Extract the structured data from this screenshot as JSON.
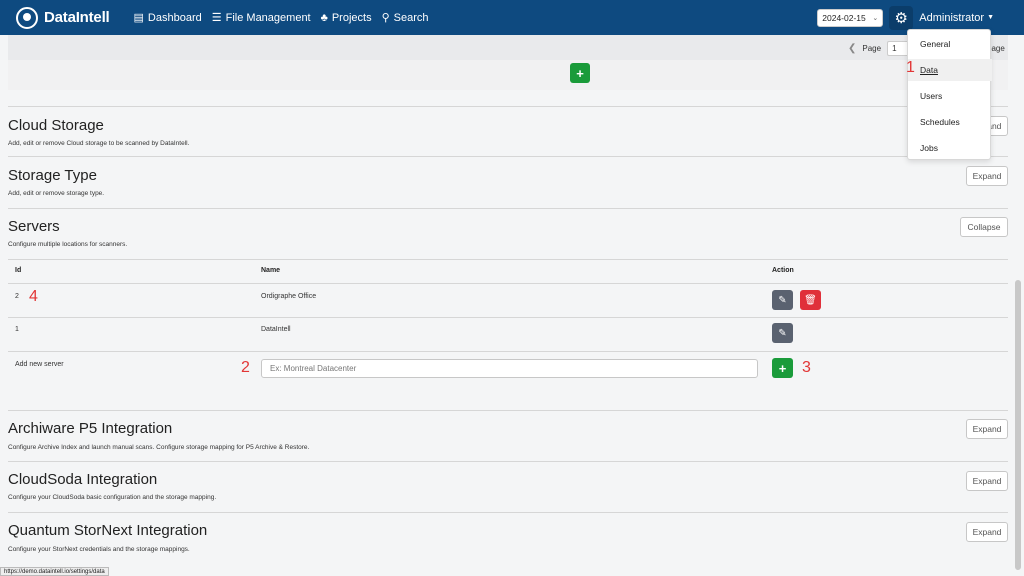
{
  "nav": {
    "brand": "DataIntell",
    "links": [
      {
        "icon": "bar-chart-icon",
        "label": "Dashboard"
      },
      {
        "icon": "list-icon",
        "label": "File Management"
      },
      {
        "icon": "sitemap-icon",
        "label": "Projects"
      },
      {
        "icon": "search-icon",
        "label": "Search"
      }
    ],
    "date": "2024-02-15",
    "user": "Administrator"
  },
  "pager": {
    "label": "Page",
    "value": "1",
    "suffix": "page"
  },
  "settings_menu": {
    "items": [
      "General",
      "Data",
      "Users",
      "Schedules",
      "Jobs"
    ],
    "active": "Data"
  },
  "sections": {
    "cloud_storage": {
      "title": "Cloud Storage",
      "desc": "Add, edit or remove Cloud storage to be scanned by DataIntell.",
      "button": "Expand"
    },
    "storage_type": {
      "title": "Storage Type",
      "desc": "Add, edit or remove storage type.",
      "button": "Expand"
    },
    "servers": {
      "title": "Servers",
      "desc": "Configure multiple locations for scanners.",
      "button": "Collapse"
    },
    "archiware": {
      "title": "Archiware P5 Integration",
      "desc": "Configure Archive Index and launch manual scans. Configure storage mapping for P5 Archive & Restore.",
      "button": "Expand"
    },
    "cloudsoda": {
      "title": "CloudSoda Integration",
      "desc": "Configure your CloudSoda basic configuration and the storage mapping.",
      "button": "Expand"
    },
    "quantum": {
      "title": "Quantum StorNext Integration",
      "desc": "Configure your StorNext credentials and the storage mappings.",
      "button": "Expand"
    }
  },
  "servers_table": {
    "columns": [
      "Id",
      "Name",
      "Action"
    ],
    "rows": [
      {
        "id": "2",
        "name": "Ordigraphe Office"
      },
      {
        "id": "1",
        "name": "DataIntell"
      }
    ],
    "add_label": "Add new server",
    "add_placeholder": "Ex: Montreal Datacenter"
  },
  "annotations": [
    "1",
    "2",
    "3",
    "4"
  ],
  "status_url": "https://demo.dataintell.io/settings/data",
  "colors": {
    "navbar": "#0e4a80",
    "accent_green": "#1a9b3a",
    "danger_red": "#e0303a",
    "annotation_red": "#e23636"
  }
}
